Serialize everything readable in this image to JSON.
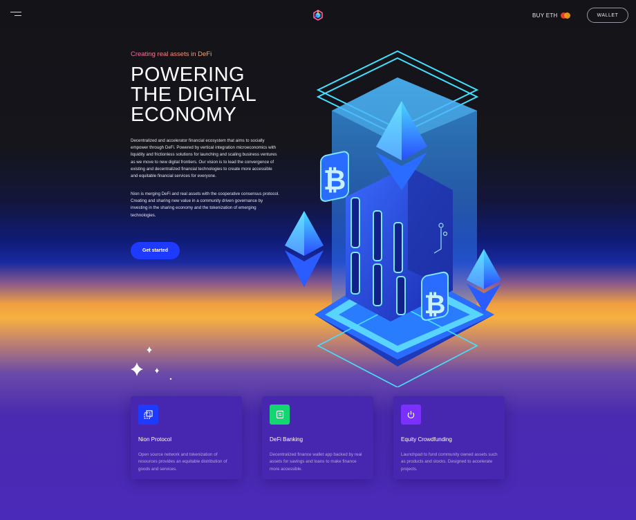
{
  "header": {
    "menu_icon": "hamburger-icon",
    "logo_icon": "cube-logo-icon",
    "buy_eth_label": "BUY ETH",
    "wallet_label": "WALLET"
  },
  "hero": {
    "kicker": "Creating real assets in DeFi",
    "headline_lines": [
      "POWERING",
      "THE DIGITAL",
      "ECONOMY"
    ],
    "paragraph_1": "Decentralized and accelerator financial ecosystem that aims to socially empower through DeFi. Powered by vertical integration microeconomics with liquidity and frictionless solutions for launching and scaling business ventures as we move to new digital frontiers. Our vision is to lead the convergence of existing and decentralized financial technologies to create more accessible and equitable financial services for everyone.",
    "paragraph_2": "Nion is merging DeFi and real assets with the cooperative consensus protocol. Creating and sharing new value in a community driven governance by investing in the sharing economy and the tokenization of emerging technologies.",
    "cta_label": "Get started"
  },
  "features": [
    {
      "icon": "layers-icon",
      "icon_color": "#1f3aff",
      "title": "Nion Protocol",
      "description": "Open source network and tokenization of resources provides an equitable distribution of goods and services."
    },
    {
      "icon": "wallet-icon",
      "icon_color": "#14d670",
      "title": "DeFi Banking",
      "description": "Decentralized finance wallet app backed by real assets for savings and loans to make finance more accessible."
    },
    {
      "icon": "power-icon",
      "icon_color": "#7a30ff",
      "title": "Equity Crowdfunding",
      "description": "Launchpad to fund community owned assets such as products and stocks. Designed to accelerate projects."
    }
  ],
  "colors": {
    "accent_blue": "#1f3aff",
    "card_bg": "#4726b0",
    "dark_bg": "#131318"
  }
}
